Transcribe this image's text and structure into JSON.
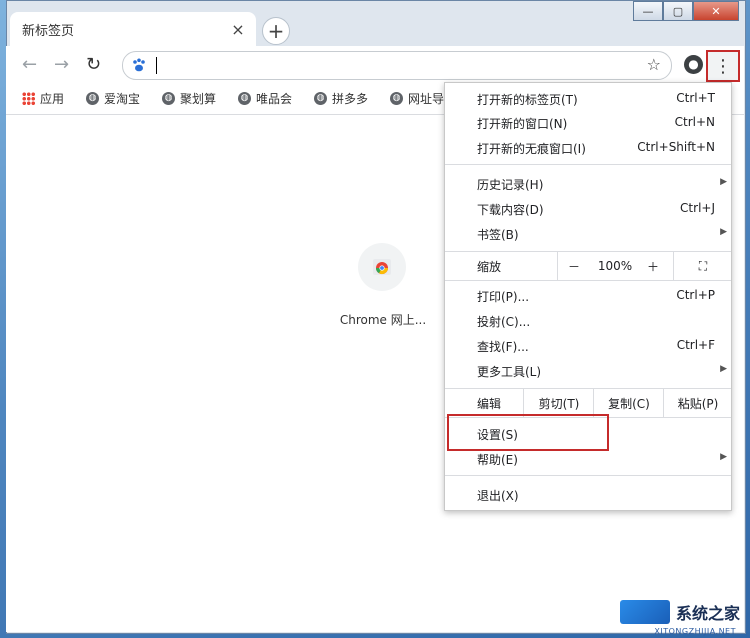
{
  "tab": {
    "title": "新标签页",
    "close": "×"
  },
  "new_tab": "+",
  "window_controls": {
    "minimize": "—",
    "maximize": "▢",
    "close": "✕"
  },
  "toolbar": {
    "back": "←",
    "forward": "→",
    "reload": "↻",
    "star": "☆",
    "menu": "⋮"
  },
  "bookmarks": [
    {
      "label": "应用"
    },
    {
      "label": "爱淘宝"
    },
    {
      "label": "聚划算"
    },
    {
      "label": "唯品会"
    },
    {
      "label": "拼多多"
    },
    {
      "label": "网址导"
    }
  ],
  "shortcut": {
    "label": "Chrome 网上..."
  },
  "menu": {
    "new_tab": {
      "label": "打开新的标签页(T)",
      "shortcut": "Ctrl+T"
    },
    "new_window": {
      "label": "打开新的窗口(N)",
      "shortcut": "Ctrl+N"
    },
    "incognito": {
      "label": "打开新的无痕窗口(I)",
      "shortcut": "Ctrl+Shift+N"
    },
    "history": {
      "label": "历史记录(H)"
    },
    "downloads": {
      "label": "下载内容(D)",
      "shortcut": "Ctrl+J"
    },
    "bookmarks": {
      "label": "书签(B)"
    },
    "zoom": {
      "label": "缩放",
      "minus": "－",
      "value": "100%",
      "plus": "＋",
      "fullscreen": "⛶"
    },
    "print": {
      "label": "打印(P)...",
      "shortcut": "Ctrl+P"
    },
    "cast": {
      "label": "投射(C)..."
    },
    "find": {
      "label": "查找(F)...",
      "shortcut": "Ctrl+F"
    },
    "more_tools": {
      "label": "更多工具(L)"
    },
    "edit": {
      "label": "编辑",
      "cut": "剪切(T)",
      "copy": "复制(C)",
      "paste": "粘贴(P)"
    },
    "settings": {
      "label": "设置(S)"
    },
    "help": {
      "label": "帮助(E)"
    },
    "exit": {
      "label": "退出(X)"
    }
  },
  "watermark": {
    "title": "系统之家",
    "subtitle": "XITONGZHIJIA.NET"
  },
  "colors": {
    "highlight": "#c52b2b",
    "accent": "#2a6fd6"
  }
}
